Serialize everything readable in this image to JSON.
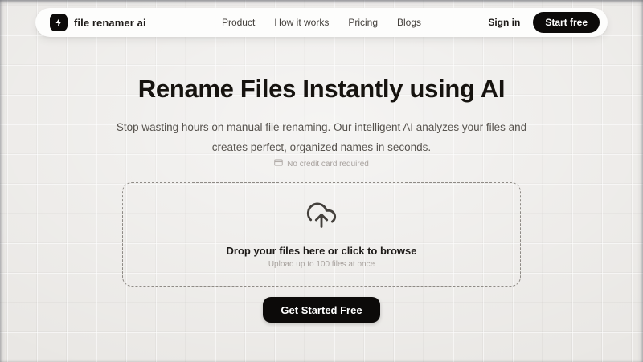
{
  "navbar": {
    "brand": "file renamer ai",
    "links": [
      {
        "label": "Product"
      },
      {
        "label": "How it works"
      },
      {
        "label": "Pricing"
      },
      {
        "label": "Blogs"
      }
    ],
    "sign_in": "Sign in",
    "cta": "Start free"
  },
  "hero": {
    "title": "Rename Files Instantly using AI",
    "subtitle_line1": "Stop wasting hours on manual file renaming. Our intelligent AI analyzes your files and",
    "subtitle_line2": "creates perfect, organized names in seconds.",
    "badge": "No credit card required"
  },
  "dropzone": {
    "main_text": "Drop your files here or click to browse",
    "sub_text": "Upload up to 100 files at once"
  },
  "cta": {
    "label": "Get Started Free"
  },
  "colors": {
    "accent": "#0c0a09",
    "background": "#e9e7e4",
    "muted_text": "#a8a29e",
    "body_text": "#57534e"
  },
  "icons": {
    "logo": "lightning-bolt-icon",
    "badge": "credit-card-icon",
    "dropzone": "cloud-upload-icon"
  }
}
